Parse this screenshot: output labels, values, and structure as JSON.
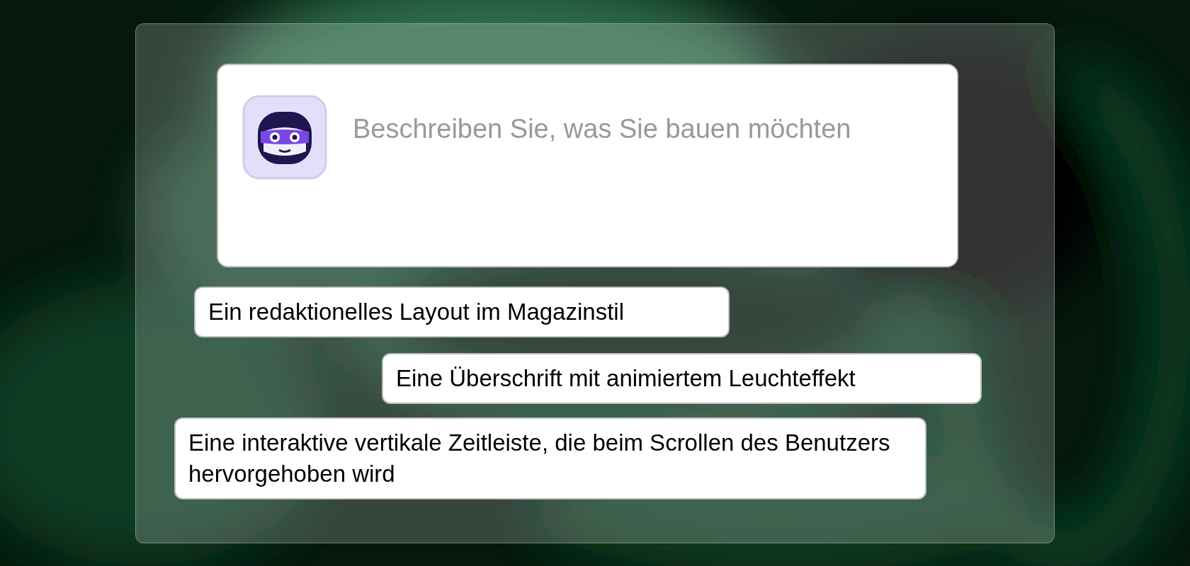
{
  "prompt": {
    "placeholder": "Beschreiben Sie, was Sie bauen möchten"
  },
  "suggestions": [
    {
      "label": "Ein redaktionelles Layout im Magazinstil"
    },
    {
      "label": "Eine Überschrift mit animiertem Leuchteffekt"
    },
    {
      "label": "Eine interaktive vertikale Zeitleiste, die beim Scrollen des Benutzers hervorgehoben wird"
    }
  ]
}
